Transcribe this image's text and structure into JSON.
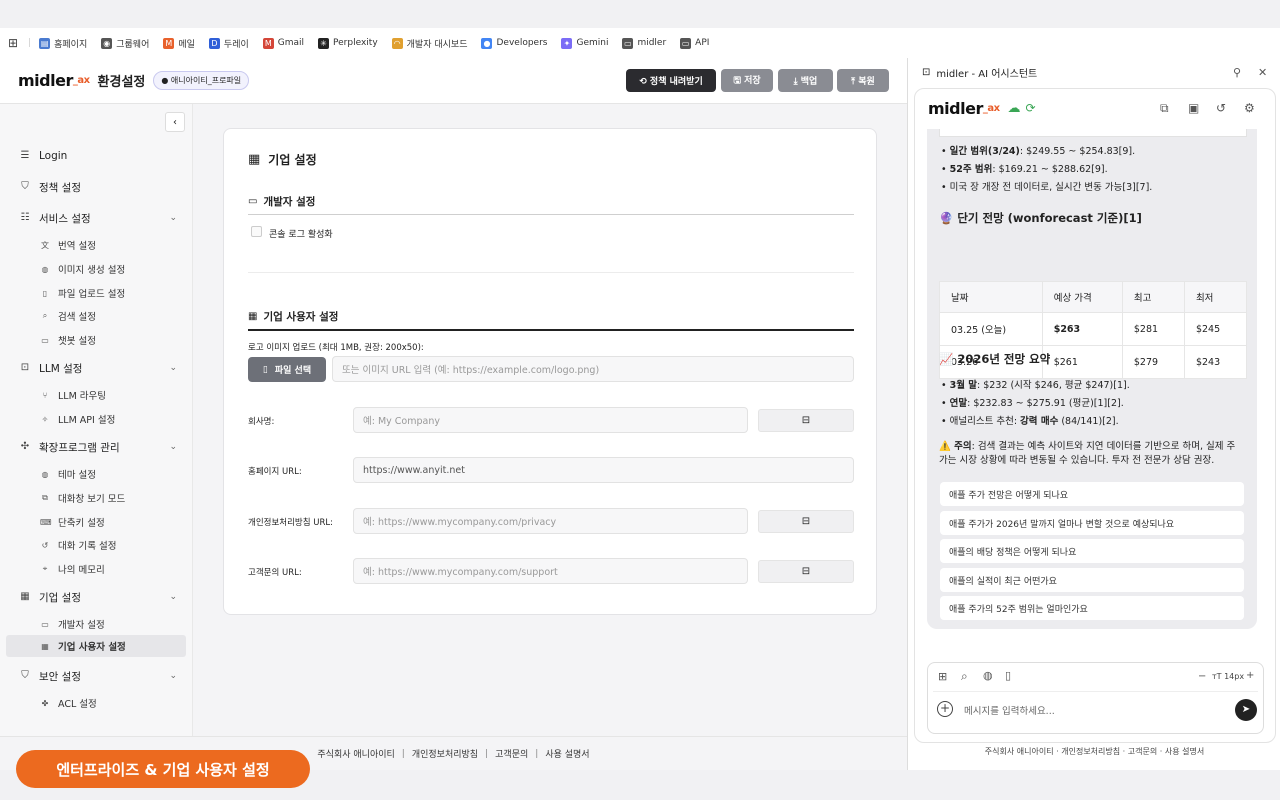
{
  "bookmarks": [
    {
      "label": "홈페이지",
      "icon": "page-icon",
      "color": "#4a7bd0"
    },
    {
      "label": "그룹웨어",
      "icon": "globe-icon",
      "color": "#555555"
    },
    {
      "label": "메일",
      "icon": "mail-icon",
      "color": "#e8612c"
    },
    {
      "label": "두레이",
      "icon": "dooray-icon",
      "color": "#2f5fd8"
    },
    {
      "label": "Gmail",
      "icon": "gmail-icon",
      "color": "#d44638"
    },
    {
      "label": "Perplexity",
      "icon": "perplexity-icon",
      "color": "#222222"
    },
    {
      "label": "개발자 대시보드",
      "icon": "rainbow-icon",
      "color": "#e0a030"
    },
    {
      "label": "Developers",
      "icon": "chrome-icon",
      "color": "#4285f4"
    },
    {
      "label": "Gemini",
      "icon": "gemini-icon",
      "color": "#7b6cf6"
    },
    {
      "label": "midler",
      "icon": "folder-icon",
      "color": "#555555"
    },
    {
      "label": "API",
      "icon": "folder-icon",
      "color": "#555555"
    }
  ],
  "header": {
    "logo": "midler",
    "logo_suffix": "_ax",
    "title": "환경설정",
    "badge": "● 애니아이티_프로파일",
    "buttons": {
      "export": "⟲ 정책 내려받기",
      "save": "🖫 저장",
      "backup": "⤓ 백업",
      "restore": "⤒ 복원"
    },
    "colors": {
      "export": "#2b2b2f",
      "other": "#8a8c93"
    }
  },
  "sidebar": {
    "login": "Login",
    "policy": "정책 설정",
    "service": "서비스 설정",
    "service_items": [
      "번역 설정",
      "이미지 생성 설정",
      "파일 업로드 설정",
      "검색 설정",
      "챗봇 설정"
    ],
    "llm": "LLM 설정",
    "llm_items": [
      "LLM 라우팅",
      "LLM API 설정"
    ],
    "ext": "확장프로그램 관리",
    "ext_items": [
      "테마 설정",
      "대화창 보기 모드",
      "단축키 설정",
      "대화 기록 설정",
      "나의 메모리"
    ],
    "enterprise": "기업 설정",
    "enterprise_items": [
      "개발자 설정",
      "기업 사용자 설정"
    ],
    "security": "보안 설정",
    "security_items": [
      "ACL 설정"
    ]
  },
  "main": {
    "title": "기업 설정",
    "dev_section": "개발자 설정",
    "console_log": "콘솔 로그 활성화",
    "user_section": "기업 사용자 설정",
    "logo_label": "로고 이미지 업로드 (최대 1MB, 권장: 200x50):",
    "file_btn": "파일 선택",
    "logo_placeholder": "또는 이미지 URL 입력 (예: https://example.com/logo.png)",
    "company_label": "회사명:",
    "company_placeholder": "예: My Company",
    "homepage_label": "홈페이지 URL:",
    "homepage_value": "https://www.anyit.net",
    "privacy_label": "개인정보처리방침 URL:",
    "privacy_placeholder": "예: https://www.mycompany.com/privacy",
    "support_label": "고객문의 URL:",
    "support_placeholder": "예: https://www.mycompany.com/support"
  },
  "footer": {
    "links": [
      "주식회사 애니아이티",
      "개인정보처리방침",
      "고객문의",
      "사용 설명서"
    ]
  },
  "toast": "엔터프라이즈 & 기업 사용자 설정",
  "panel": {
    "title": "midler - AI 어시스턴트",
    "logo": "midler",
    "logo_suffix": "_ax",
    "bullets1": [
      {
        "bold": "일간 범위(3/24)",
        "text": ": $249.55 ~ $254.83[9]."
      },
      {
        "bold": "52주 범위",
        "text": ": $169.21 ~ $288.62[9]."
      },
      {
        "bold": "",
        "text": "미국 장 개장 전 데이터로, 실시간 변동 가능[3][7]."
      }
    ],
    "forecast_title": "🔮 단기 전망 (wonforecast 기준)[1]",
    "table": {
      "headers": [
        "날짜",
        "예상 가격",
        "최고",
        "최저"
      ],
      "rows": [
        [
          "03.25 (오늘)",
          "$263",
          "$281",
          "$245"
        ],
        [
          "03.26",
          "$261",
          "$279",
          "$243"
        ]
      ]
    },
    "summary_title": "📈 2026년 전망 요약",
    "bullets2": [
      {
        "bold": "3월 말",
        "text": ": $232 (시작 $246, 평균 $247)[1]."
      },
      {
        "bold": "연말",
        "text": ": $232.83 ~ $275.91 (평균)[1][2]."
      },
      {
        "pre": "애널리스트 추천: ",
        "bold": "강력 매수",
        "text": " (84/141)[2]."
      }
    ],
    "note_bold": "⚠️ 주의",
    "note_text": ": 검색 결과는 예측 사이트와 지연 데이터를 기반으로 하며, 실제 주가는 시장 상황에 따라 변동될 수 있습니다. 투자 전 전문가 상담 권장.",
    "suggestions": [
      "애플 주가 전망은 어떻게 되나요",
      "애플 주가가 2026년 말까지 얼마나 변할 것으로 예상되나요",
      "애플의 배당 정책은 어떻게 되나요",
      "애플의 실적이 최근 어떤가요",
      "애플 주가의 52주 범위는 얼마인가요"
    ],
    "font_size": "ᴛT 14px",
    "input_placeholder": "메시지를 입력하세요...",
    "footer": [
      "주식회사 애니아이티",
      "개인정보처리방침",
      "고객문의",
      "사용 설명서"
    ]
  }
}
